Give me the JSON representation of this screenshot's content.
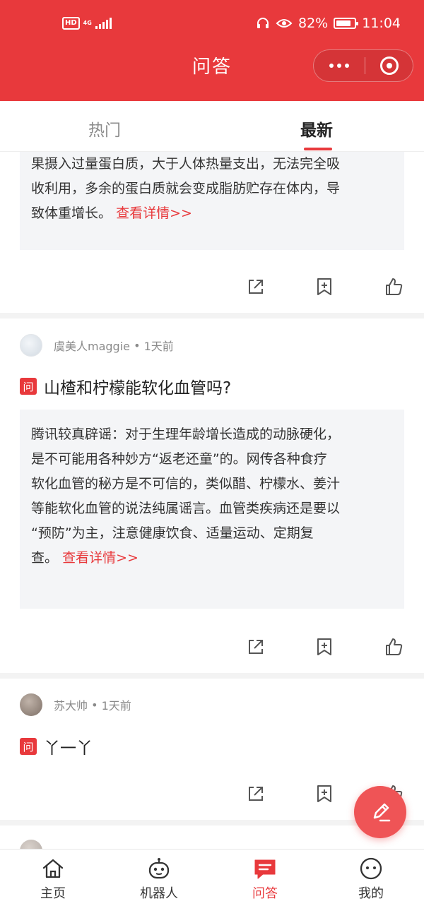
{
  "status_bar": {
    "network_badge": "HD",
    "network_type": "4G",
    "battery_percent": "82%",
    "battery_level": 0.82,
    "time": "11:04"
  },
  "header": {
    "title": "问答",
    "more_icon": "more-dots-icon",
    "close_icon": "capsule-close-icon"
  },
  "tabs": [
    {
      "label": "热门",
      "active": false
    },
    {
      "label": "最新",
      "active": true
    }
  ],
  "feed": [
    {
      "answer_lines": [
        "果摄入过量蛋白质，大于人体热量支出，无法完全吸",
        "收利用，多余的蛋白质就会变成脂肪贮存在体内，导",
        "致体重增长。"
      ],
      "detail_link": "查看详情>>"
    },
    {
      "author": "虞美人maggie",
      "time_ago": "1天前",
      "question_badge": "问",
      "question": "山楂和柠檬能软化血管吗?",
      "answer_lines": [
        "腾讯较真辟谣：对于生理年龄增长造成的动脉硬化，",
        "是不可能用各种妙方“返老还童”的。网传各种食疗",
        "软化血管的秘方是不可信的，类似醋、柠檬水、姜汁",
        "等能软化血管的说法纯属谣言。血管类疾病还是要以",
        "“预防”为主，注意健康饮食、适量运动、定期复",
        "查。"
      ],
      "detail_link": "查看详情>>"
    },
    {
      "author": "苏大帅",
      "time_ago": "1天前",
      "question_badge": "问",
      "question": "丫一丫"
    }
  ],
  "actions": {
    "share_icon": "share-icon",
    "bookmark_icon": "bookmark-add-icon",
    "like_icon": "thumbs-up-icon"
  },
  "fab": {
    "icon": "pencil-icon"
  },
  "bottom_nav": [
    {
      "label": "主页",
      "icon": "home-icon",
      "active": false
    },
    {
      "label": "机器人",
      "icon": "robot-icon",
      "active": false
    },
    {
      "label": "问答",
      "icon": "qa-chat-icon",
      "active": true
    },
    {
      "label": "我的",
      "icon": "profile-face-icon",
      "active": false
    }
  ],
  "colors": {
    "brand": "#e8393c",
    "fab": "#ef5456"
  }
}
